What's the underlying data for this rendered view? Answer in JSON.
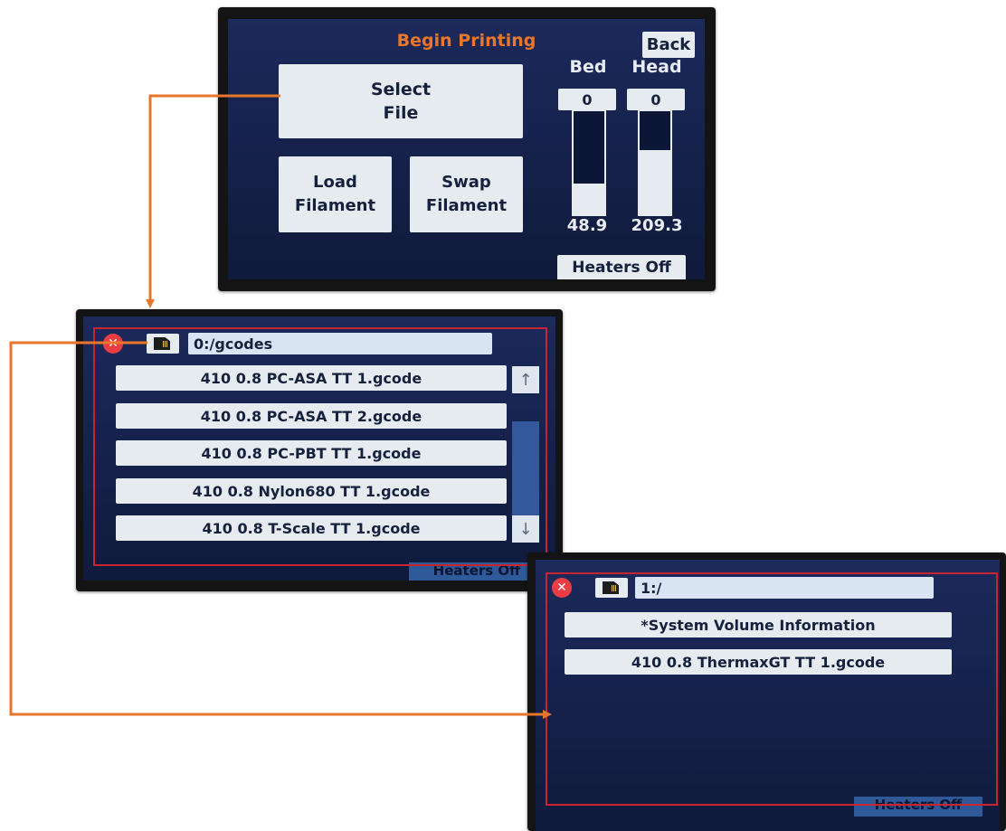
{
  "begin_printing_screen": {
    "title": "Begin Printing",
    "back_label": "Back",
    "select_file_label": "Select\nFile",
    "load_filament_label": "Load\nFilament",
    "swap_filament_label": "Swap\nFilament",
    "bed_label": "Bed",
    "head_label": "Head",
    "bed_setpoint": "0",
    "head_setpoint": "0",
    "bed_temp": "48.9",
    "head_temp": "209.3",
    "bed_level_fraction": 0.3,
    "head_level_fraction": 0.62,
    "heaters_label": "Heaters Off"
  },
  "file_browser_gcodes": {
    "close_icon": "close-icon",
    "card_icon": "sd-card-icon",
    "path": "0:/gcodes",
    "files": [
      "410 0.8 PC-ASA TT 1.gcode",
      "410 0.8 PC-ASA TT 2.gcode",
      "410 0.8 PC-PBT TT 1.gcode",
      "410 0.8 Nylon680 TT 1.gcode",
      "410 0.8 T-Scale TT 1.gcode"
    ],
    "scroll_up_glyph": "↑",
    "scroll_down_glyph": "↓",
    "heaters_label": "Heaters Off"
  },
  "file_browser_root": {
    "close_icon": "close-icon",
    "card_icon": "sd-card-icon",
    "path": "1:/",
    "files": [
      "*System Volume Information",
      "410 0.8 ThermaxGT TT 1.gcode"
    ],
    "heaters_label": "Heaters Off"
  },
  "colors": {
    "arrow": "#e8762b",
    "screen_bg": "#1c2a5c",
    "button_bg": "#e6ebf0",
    "title": "#e8762b",
    "frame_red": "#c8242e"
  }
}
